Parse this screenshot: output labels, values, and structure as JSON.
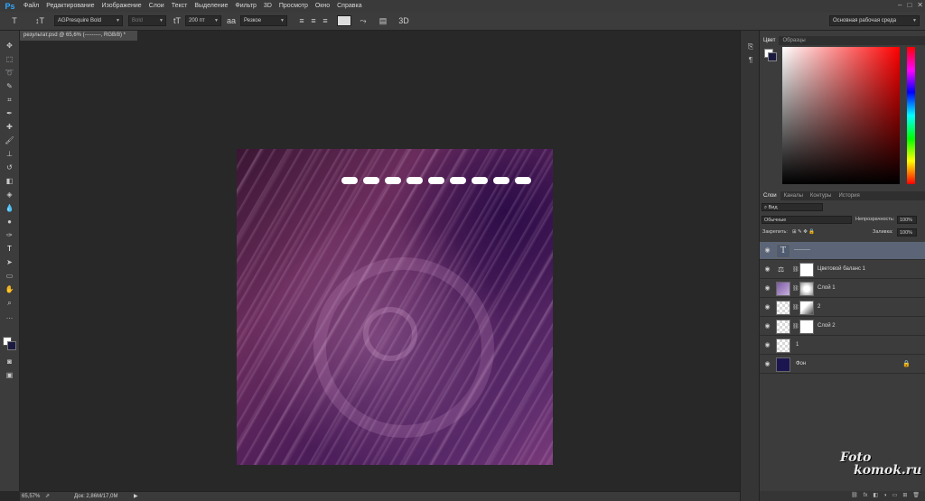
{
  "app": {
    "logo": "Ps"
  },
  "menu": [
    "Файл",
    "Редактирование",
    "Изображение",
    "Слои",
    "Текст",
    "Выделение",
    "Фильтр",
    "3D",
    "Просмотр",
    "Окно",
    "Справка"
  ],
  "window_controls": {
    "minimize": "–",
    "maximize": "□",
    "close": "✕"
  },
  "options": {
    "font_family": "AGPresquire Bold",
    "font_style": "Bold",
    "font_size": "200 пт",
    "antialias": "Резкое",
    "workspace": "Основная рабочая среда",
    "text_color": "#ffffff"
  },
  "document": {
    "tab_title": "результат.psd @ 65,6% (---------, RGB/8) *",
    "zoom": "65,57%",
    "doc_info": "Док: 2,86M/17,0M"
  },
  "panels": {
    "color_tabs": [
      "Цвет",
      "Образцы"
    ],
    "layers_tabs": [
      "Слои",
      "Каналы",
      "Контуры",
      "История"
    ],
    "filter_kind": "Вид",
    "blend_mode": "Обычные",
    "opacity_label": "Непрозрачность:",
    "opacity_value": "100%",
    "lock_label": "Закрепить:",
    "fill_label": "Заливка:",
    "fill_value": "100%"
  },
  "layers": [
    {
      "name": "---------",
      "type": "text",
      "selected": true
    },
    {
      "name": "Цветовой баланс 1",
      "type": "adjustment"
    },
    {
      "name": "Слой 1",
      "type": "masked"
    },
    {
      "name": "2",
      "type": "masked"
    },
    {
      "name": "Слой 2",
      "type": "masked"
    },
    {
      "name": "1",
      "type": "plain"
    },
    {
      "name": "Фон",
      "type": "background",
      "locked": true
    }
  ],
  "colors": {
    "foreground": "#ffffff",
    "background": "#1a1a40",
    "accent": "#31a8ff"
  },
  "watermark": {
    "line1": "Foto",
    "line2": "komok.ru"
  }
}
